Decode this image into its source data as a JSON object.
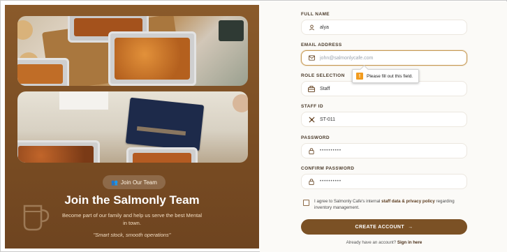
{
  "left_panel": {
    "badge": "Join Our Team",
    "title": "Join the Salmonly Team",
    "description": "Become part of our family and help us serve the best Mental in town.",
    "quote": "\"Smart stock, smooth operations\""
  },
  "form": {
    "full_name": {
      "label": "FULL NAME",
      "value": "alya",
      "icon": "user-icon"
    },
    "email": {
      "label": "EMAIL ADDRESS",
      "placeholder": "john@salmonlycafe.com",
      "icon": "mail-icon"
    },
    "role": {
      "label": "ROLE SELECTION",
      "value": "Staff",
      "icon": "briefcase-icon"
    },
    "staff_id": {
      "label": "STAFF ID",
      "value": "ST-011",
      "icon": "id-icon"
    },
    "password": {
      "label": "PASSWORD",
      "value": "••••••••••",
      "icon": "lock-icon"
    },
    "confirm_password": {
      "label": "CONFIRM PASSWORD",
      "value": "••••••••••",
      "icon": "lock-icon"
    },
    "validation_tooltip": "Please fill out this field.",
    "agree_prefix": "I agree to Salmonly Cafe's internal ",
    "agree_link": "staff data & privacy policy",
    "agree_suffix": " regarding inventory management.",
    "submit": "CREATE ACCOUNT",
    "signin_prefix": "Already have an account? ",
    "signin_link": "Sign in here"
  },
  "colors": {
    "brand_brown": "#7b5125",
    "panel_brown": "#8a5a2b",
    "warning": "#f29c1f"
  }
}
